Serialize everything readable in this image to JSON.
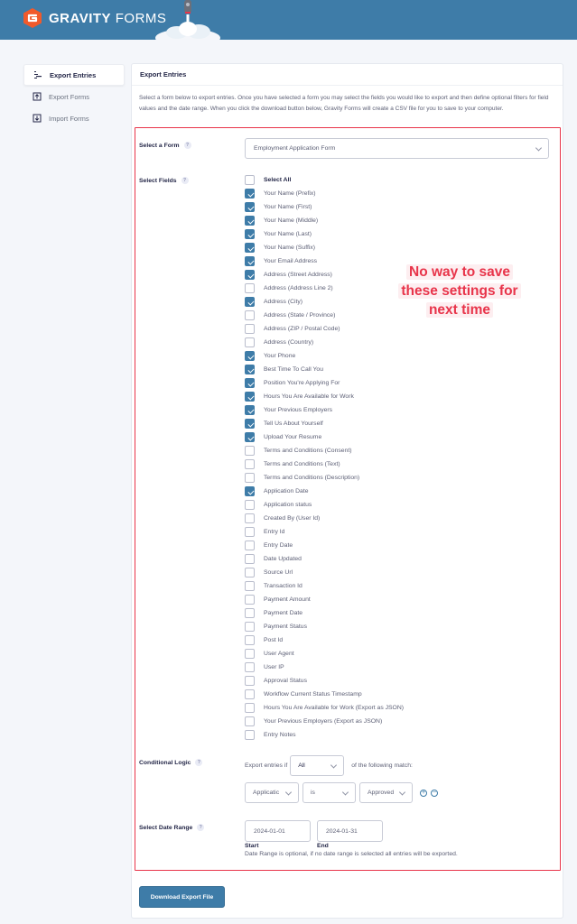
{
  "header": {
    "logo_bold": "GRAVITY",
    "logo_light": "FORMS",
    "logo_icon": "gravity-forms-logo-icon",
    "mascot_icon": "rocket-icon"
  },
  "sidebar": {
    "items": [
      {
        "label": "Export Entries",
        "icon": "export-entries-icon",
        "active": true
      },
      {
        "label": "Export Forms",
        "icon": "export-forms-icon",
        "active": false
      },
      {
        "label": "Import Forms",
        "icon": "import-forms-icon",
        "active": false
      }
    ]
  },
  "panel": {
    "title": "Export Entries",
    "description": "Select a form below to export entries. Once you have selected a form you may select the fields you would like to export and then define optional filters for field values and the date range. When you click the download button below, Gravity Forms will create a CSV file for you to save to your computer.",
    "select_form": {
      "label": "Select a Form",
      "help": "?",
      "value": "Employment Application Form"
    },
    "select_fields": {
      "label": "Select Fields",
      "help": "?",
      "select_all": {
        "label": "Select All",
        "checked": false
      },
      "fields": [
        {
          "label": "Your Name (Prefix)",
          "checked": true
        },
        {
          "label": "Your Name (First)",
          "checked": true
        },
        {
          "label": "Your Name (Middle)",
          "checked": true
        },
        {
          "label": "Your Name (Last)",
          "checked": true
        },
        {
          "label": "Your Name (Suffix)",
          "checked": true
        },
        {
          "label": "Your Email Address",
          "checked": true
        },
        {
          "label": "Address (Street Address)",
          "checked": true
        },
        {
          "label": "Address (Address Line 2)",
          "checked": false
        },
        {
          "label": "Address (City)",
          "checked": true
        },
        {
          "label": "Address (State / Province)",
          "checked": false
        },
        {
          "label": "Address (ZIP / Postal Code)",
          "checked": false
        },
        {
          "label": "Address (Country)",
          "checked": false
        },
        {
          "label": "Your Phone",
          "checked": true
        },
        {
          "label": "Best Time To Call You",
          "checked": true
        },
        {
          "label": "Position You're Applying For",
          "checked": true
        },
        {
          "label": "Hours You Are Available for Work",
          "checked": true
        },
        {
          "label": "Your Previous Employers",
          "checked": true
        },
        {
          "label": "Tell Us About Yourself",
          "checked": true
        },
        {
          "label": "Upload Your Resume",
          "checked": true
        },
        {
          "label": "Terms and Conditions (Consent)",
          "checked": false
        },
        {
          "label": "Terms and Conditions (Text)",
          "checked": false
        },
        {
          "label": "Terms and Conditions (Description)",
          "checked": false
        },
        {
          "label": "Application Date",
          "checked": true
        },
        {
          "label": "Application status",
          "checked": false
        },
        {
          "label": "Created By (User Id)",
          "checked": false
        },
        {
          "label": "Entry Id",
          "checked": false
        },
        {
          "label": "Entry Date",
          "checked": false
        },
        {
          "label": "Date Updated",
          "checked": false
        },
        {
          "label": "Source Url",
          "checked": false
        },
        {
          "label": "Transaction Id",
          "checked": false
        },
        {
          "label": "Payment Amount",
          "checked": false
        },
        {
          "label": "Payment Date",
          "checked": false
        },
        {
          "label": "Payment Status",
          "checked": false
        },
        {
          "label": "Post Id",
          "checked": false
        },
        {
          "label": "User Agent",
          "checked": false
        },
        {
          "label": "User IP",
          "checked": false
        },
        {
          "label": "Approval Status",
          "checked": false
        },
        {
          "label": "Workflow Current Status Timestamp",
          "checked": false
        },
        {
          "label": "Hours You Are Available for Work (Export as JSON)",
          "checked": false
        },
        {
          "label": "Your Previous Employers (Export as JSON)",
          "checked": false
        },
        {
          "label": "Entry Notes",
          "checked": false
        }
      ]
    },
    "annotation": {
      "lines": [
        "No way to save",
        "these settings for",
        "next time"
      ]
    },
    "conditional_logic": {
      "label": "Conditional Logic",
      "help": "?",
      "prefix": "Export entries if",
      "match_value": "All",
      "suffix": "of the following match:",
      "rule": {
        "field": "Applicatic",
        "operator": "is",
        "value": "Approved"
      },
      "add_symbol": "+",
      "remove_symbol": "−"
    },
    "date_range": {
      "label": "Select Date Range",
      "help": "?",
      "start_value": "2024-01-01",
      "end_value": "2024-01-31",
      "start_label": "Start",
      "end_label": "End",
      "help_text": "Date Range is optional, if no date range is selected all entries will be exported."
    },
    "download_button": "Download Export File"
  },
  "colors": {
    "header_bg": "#3e7ca8",
    "accent": "#3e7ca8",
    "logo_orange": "#f15a2b",
    "annotation_red": "#e8344a",
    "page_bg": "#f4f6fa"
  }
}
